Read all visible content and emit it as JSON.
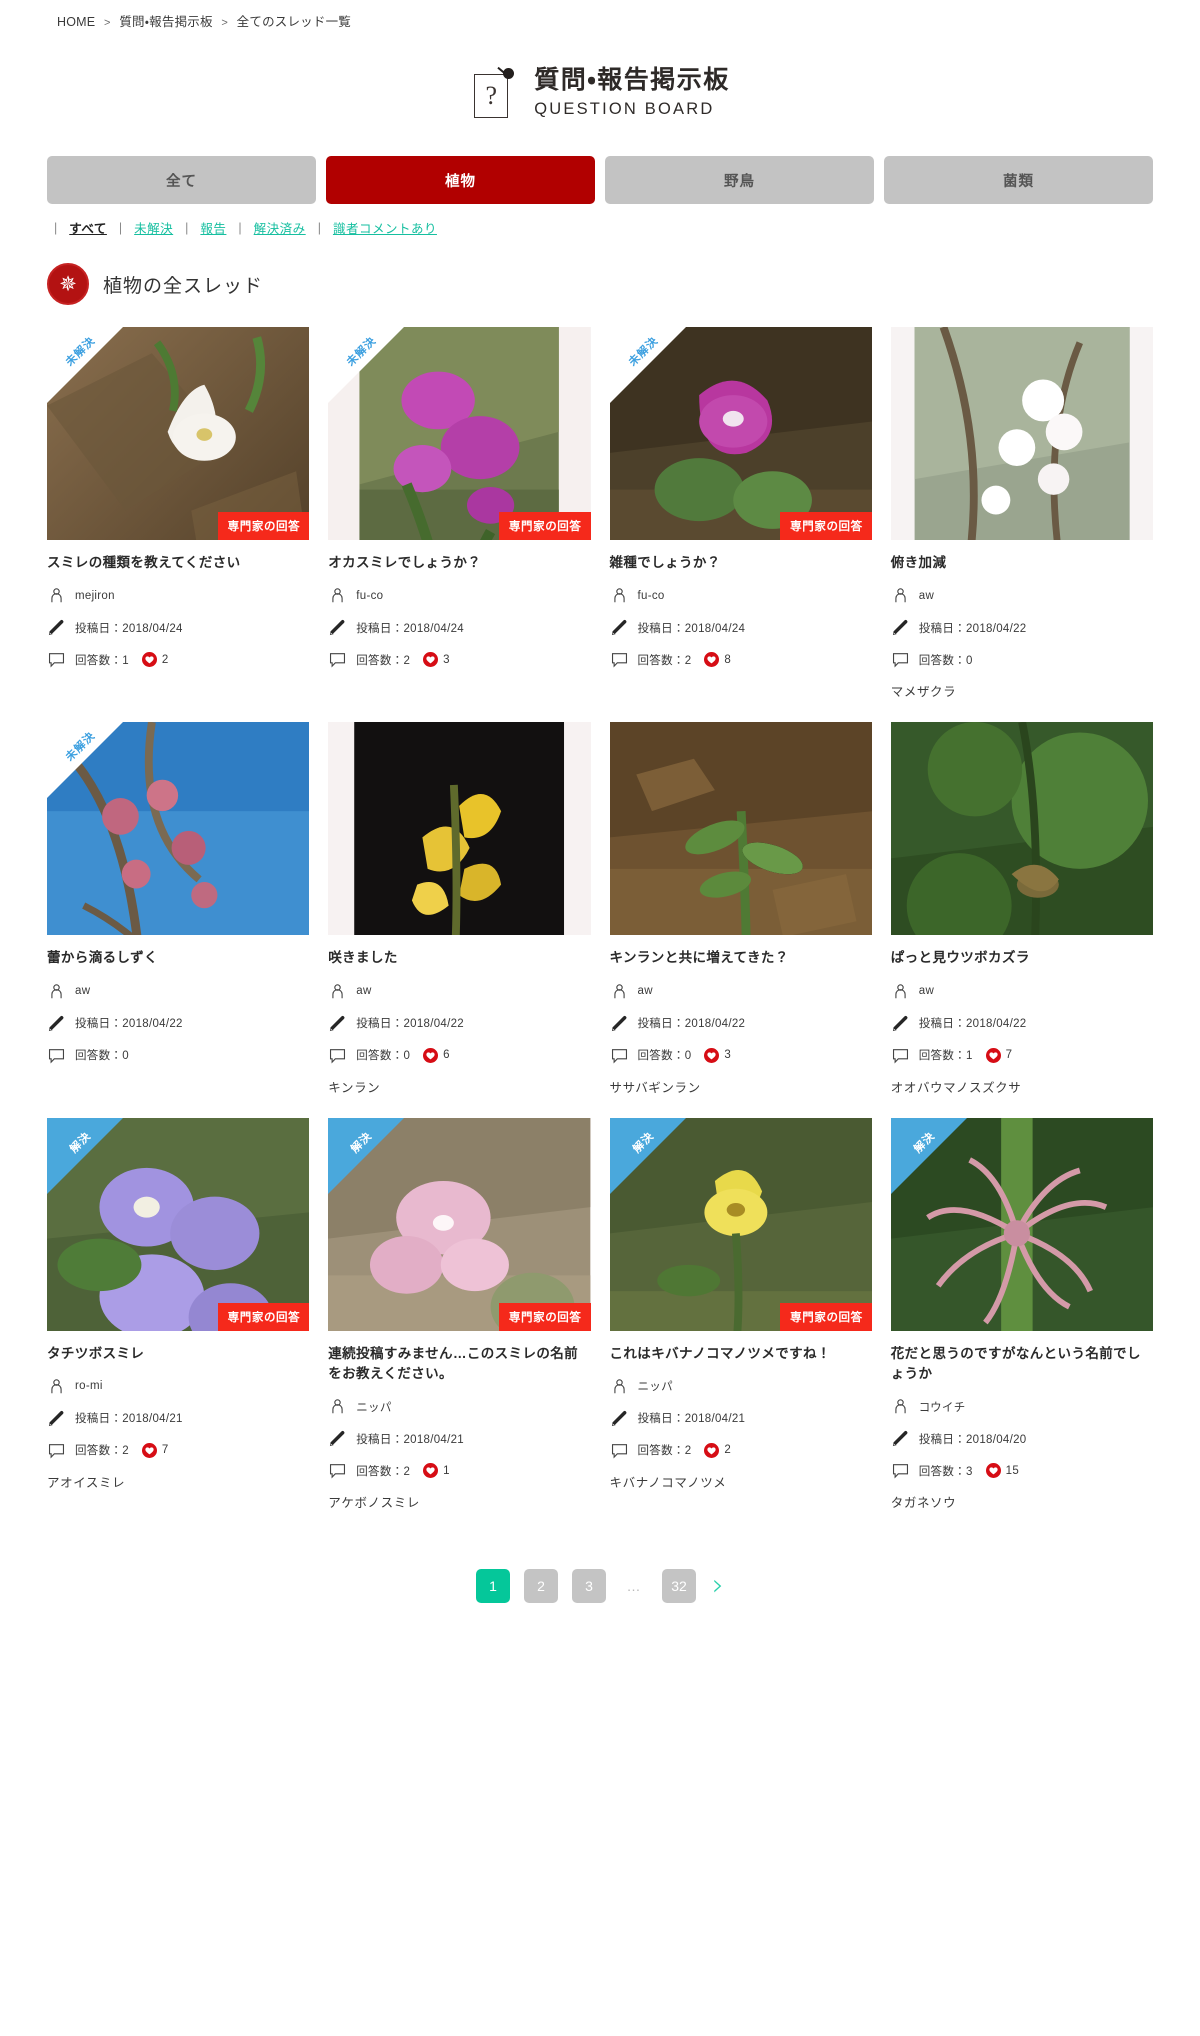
{
  "breadcrumb": {
    "items": [
      {
        "label": "HOME"
      },
      {
        "label": "質問・報告掲示板"
      },
      {
        "label": "全てのスレッド一覧"
      }
    ],
    "separator": ">"
  },
  "header": {
    "icon": "question-board-icon",
    "title_jp": "質問・報告掲示板",
    "title_en": "QUESTION BOARD",
    "question_mark": "?"
  },
  "tabs": [
    {
      "label": "全て",
      "active": false
    },
    {
      "label": "植物",
      "active": true
    },
    {
      "label": "野鳥",
      "active": false
    },
    {
      "label": "菌類",
      "active": false
    }
  ],
  "filters": [
    {
      "label": "すべて",
      "current": true
    },
    {
      "label": "未解決",
      "current": false
    },
    {
      "label": "報告",
      "current": false
    },
    {
      "label": "解決済み",
      "current": false
    },
    {
      "label": "識者コメントあり",
      "current": false
    }
  ],
  "section": {
    "badge_icon": "flower-badge-icon",
    "badge_glyph": "✵",
    "title": "植物の全スレッド"
  },
  "labels": {
    "posted_prefix": "投稿日：",
    "answers_prefix": "回答数：",
    "status_unsolved": "未解決",
    "status_solved": "解決",
    "expert_badge": "専門家の回答"
  },
  "cards": [
    {
      "title": "スミレの種類を教えてください",
      "author": "mejiron",
      "date": "2018/04/24",
      "answers": "1",
      "likes": "2",
      "species": "",
      "status": "unsolved",
      "expert": true,
      "image": {
        "base": "#6d5a43",
        "accent": "#f4f1ec",
        "kind": "violet-white-soil"
      }
    },
    {
      "title": "オカスミレでしょうか？",
      "author": "fu-co",
      "date": "2018/04/24",
      "answers": "2",
      "likes": "3",
      "species": "",
      "status": "unsolved",
      "expert": true,
      "image": {
        "base": "#7d8a5a",
        "accent": "#c24ab5",
        "kind": "violet-magenta"
      }
    },
    {
      "title": "雑種でしょうか？",
      "author": "fu-co",
      "date": "2018/04/24",
      "answers": "2",
      "likes": "8",
      "species": "",
      "status": "unsolved",
      "expert": true,
      "image": {
        "base": "#5c4f33",
        "accent": "#b8379f",
        "kind": "violet-pink-leaf"
      }
    },
    {
      "title": "俯き加減",
      "author": "aw",
      "date": "2018/04/22",
      "answers": "0",
      "likes": "",
      "species": "マメザクラ",
      "status": "none",
      "expert": false,
      "image": {
        "base": "#8e9a86",
        "accent": "#ffffff",
        "kind": "cherry-white"
      }
    },
    {
      "title": "蕾から滴るしずく",
      "author": "aw",
      "date": "2018/04/22",
      "answers": "0",
      "likes": "",
      "species": "",
      "status": "unsolved",
      "expert": false,
      "image": {
        "base": "#3f8fd0",
        "accent": "#cc7a8f",
        "kind": "buds-sky"
      }
    },
    {
      "title": "咲きました",
      "author": "aw",
      "date": "2018/04/22",
      "answers": "0",
      "likes": "6",
      "species": "キンラン",
      "status": "none",
      "expert": false,
      "image": {
        "base": "#141211",
        "accent": "#e8c32a",
        "kind": "yellow-orchid-dark"
      }
    },
    {
      "title": "キンランと共に増えてきた？",
      "author": "aw",
      "date": "2018/04/22",
      "answers": "0",
      "likes": "3",
      "species": "ササバギンラン",
      "status": "none",
      "expert": false,
      "image": {
        "base": "#7a5a36",
        "accent": "#7fae5a",
        "kind": "sprout-litter"
      }
    },
    {
      "title": "ぱっと見ウツボカズラ",
      "author": "aw",
      "date": "2018/04/22",
      "answers": "1",
      "likes": "7",
      "species": "オオバウマノスズクサ",
      "status": "none",
      "expert": false,
      "image": {
        "base": "#2f4f22",
        "accent": "#6fa24a",
        "kind": "green-vine"
      }
    },
    {
      "title": "タチツボスミレ",
      "author": "ro-mi",
      "date": "2018/04/21",
      "answers": "2",
      "likes": "7",
      "species": "アオイスミレ",
      "status": "solved",
      "expert": true,
      "image": {
        "base": "#4d5f3a",
        "accent": "#a193e0",
        "kind": "violet-lavender"
      }
    },
    {
      "title": "連続投稿すみません…このスミレの名前をお教えください。",
      "author": "ニッパ",
      "date": "2018/04/21",
      "answers": "2",
      "likes": "1",
      "species": "アケボノスミレ",
      "status": "solved",
      "expert": true,
      "image": {
        "base": "#9b8e78",
        "accent": "#e8b9cf",
        "kind": "violet-pale-pink"
      }
    },
    {
      "title": "これはキバナノコマノツメですね！",
      "author": "ニッパ",
      "date": "2018/04/21",
      "answers": "2",
      "likes": "2",
      "species": "キバナノコマノツメ",
      "status": "solved",
      "expert": true,
      "image": {
        "base": "#5c6b3b",
        "accent": "#e8d94a",
        "kind": "yellow-violet"
      }
    },
    {
      "title": "花だと思うのですがなんという名前でしょうか",
      "author": "コウイチ",
      "date": "2018/04/20",
      "answers": "3",
      "likes": "15",
      "species": "タガネソウ",
      "status": "solved",
      "expert": false,
      "image": {
        "base": "#3c5c2c",
        "accent": "#d49aa8",
        "kind": "pink-spider-flower"
      }
    }
  ],
  "pagination": {
    "pages": [
      {
        "label": "1",
        "active": true
      },
      {
        "label": "2",
        "active": false
      },
      {
        "label": "3",
        "active": false
      }
    ],
    "ellipsis": "…",
    "last": {
      "label": "32",
      "active": false
    },
    "next_icon": "chevron-right-icon",
    "next_glyph": "›"
  },
  "colors": {
    "brand_red": "#b10000",
    "accent_teal": "#16bfa0",
    "expert_red": "#f5291b",
    "solved_blue": "#4aa8dc",
    "unsolved_blue": "#3da0e0",
    "page_active": "#05c79a"
  }
}
